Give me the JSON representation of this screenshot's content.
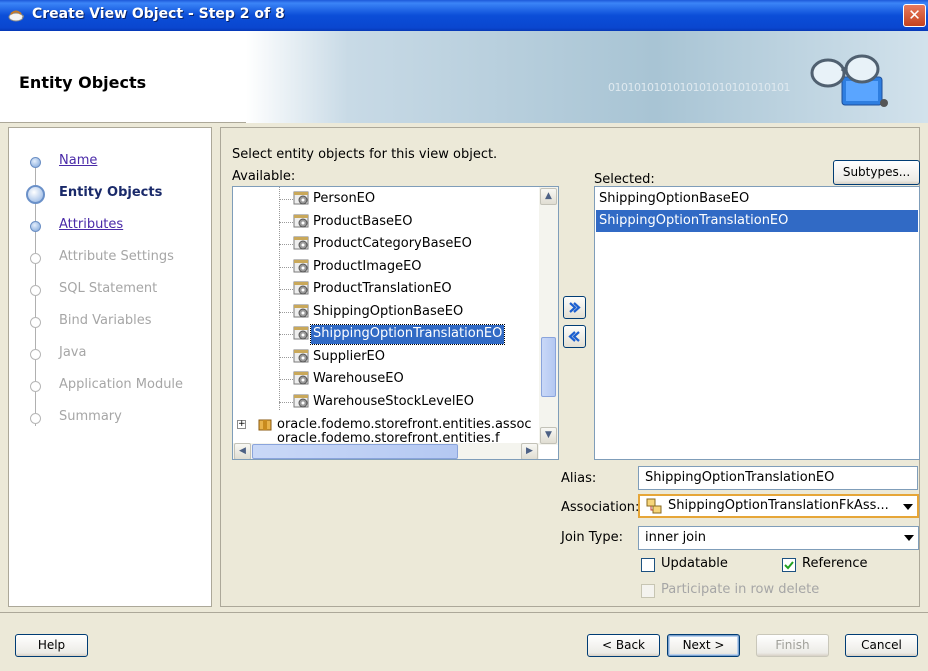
{
  "window": {
    "title": "Create View Object - Step 2 of 8",
    "close_label": "✕"
  },
  "banner": {
    "title": "Entity Objects",
    "binary_text": "0101010101010101010101010101"
  },
  "nav": {
    "items": [
      {
        "label": "Name",
        "state": "link"
      },
      {
        "label": "Entity Objects",
        "state": "active"
      },
      {
        "label": "Attributes",
        "state": "link"
      },
      {
        "label": "Attribute Settings",
        "state": "disabled"
      },
      {
        "label": "SQL Statement",
        "state": "disabled"
      },
      {
        "label": "Bind Variables",
        "state": "disabled"
      },
      {
        "label": "Java",
        "state": "disabled"
      },
      {
        "label": "Application Module",
        "state": "disabled"
      },
      {
        "label": "Summary",
        "state": "disabled"
      }
    ]
  },
  "main": {
    "instruction": "Select entity objects for this view object.",
    "available_label": "Available:",
    "selected_label": "Selected:",
    "subtypes_label": "Subtypes...",
    "available_items": [
      "PersonEO",
      "ProductBaseEO",
      "ProductCategoryBaseEO",
      "ProductImageEO",
      "ProductTranslationEO",
      "ShippingOptionBaseEO",
      "ShippingOptionTranslationEO",
      "SupplierEO",
      "WarehouseEO",
      "WarehouseStockLevelEO"
    ],
    "available_selected_index": 6,
    "package_node": "oracle.fodemo.storefront.entities.assoc",
    "package_node_partial": "oracle.fodemo.storefront.entities.f",
    "selected_items": [
      {
        "label": "ShippingOptionBaseEO",
        "selected": false
      },
      {
        "label": "ShippingOptionTranslationEO",
        "selected": true
      }
    ],
    "alias_label": "Alias:",
    "alias_value": "ShippingOptionTranslationEO",
    "association_label": "Association:",
    "association_value": "ShippingOptionTranslationFkAss...",
    "join_type_label": "Join Type:",
    "join_type_value": "inner join",
    "updatable_label": "Updatable",
    "updatable_checked": false,
    "reference_label": "Reference",
    "reference_checked": true,
    "participate_label": "Participate in row delete",
    "participate_checked": false
  },
  "footer": {
    "help_label": "Help",
    "back_label": "< Back",
    "next_label": "Next >",
    "finish_label": "Finish",
    "cancel_label": "Cancel"
  },
  "colors": {
    "selection": "#316ac5",
    "title_bar": "#0a46cf",
    "link": "#4a2aa8"
  }
}
